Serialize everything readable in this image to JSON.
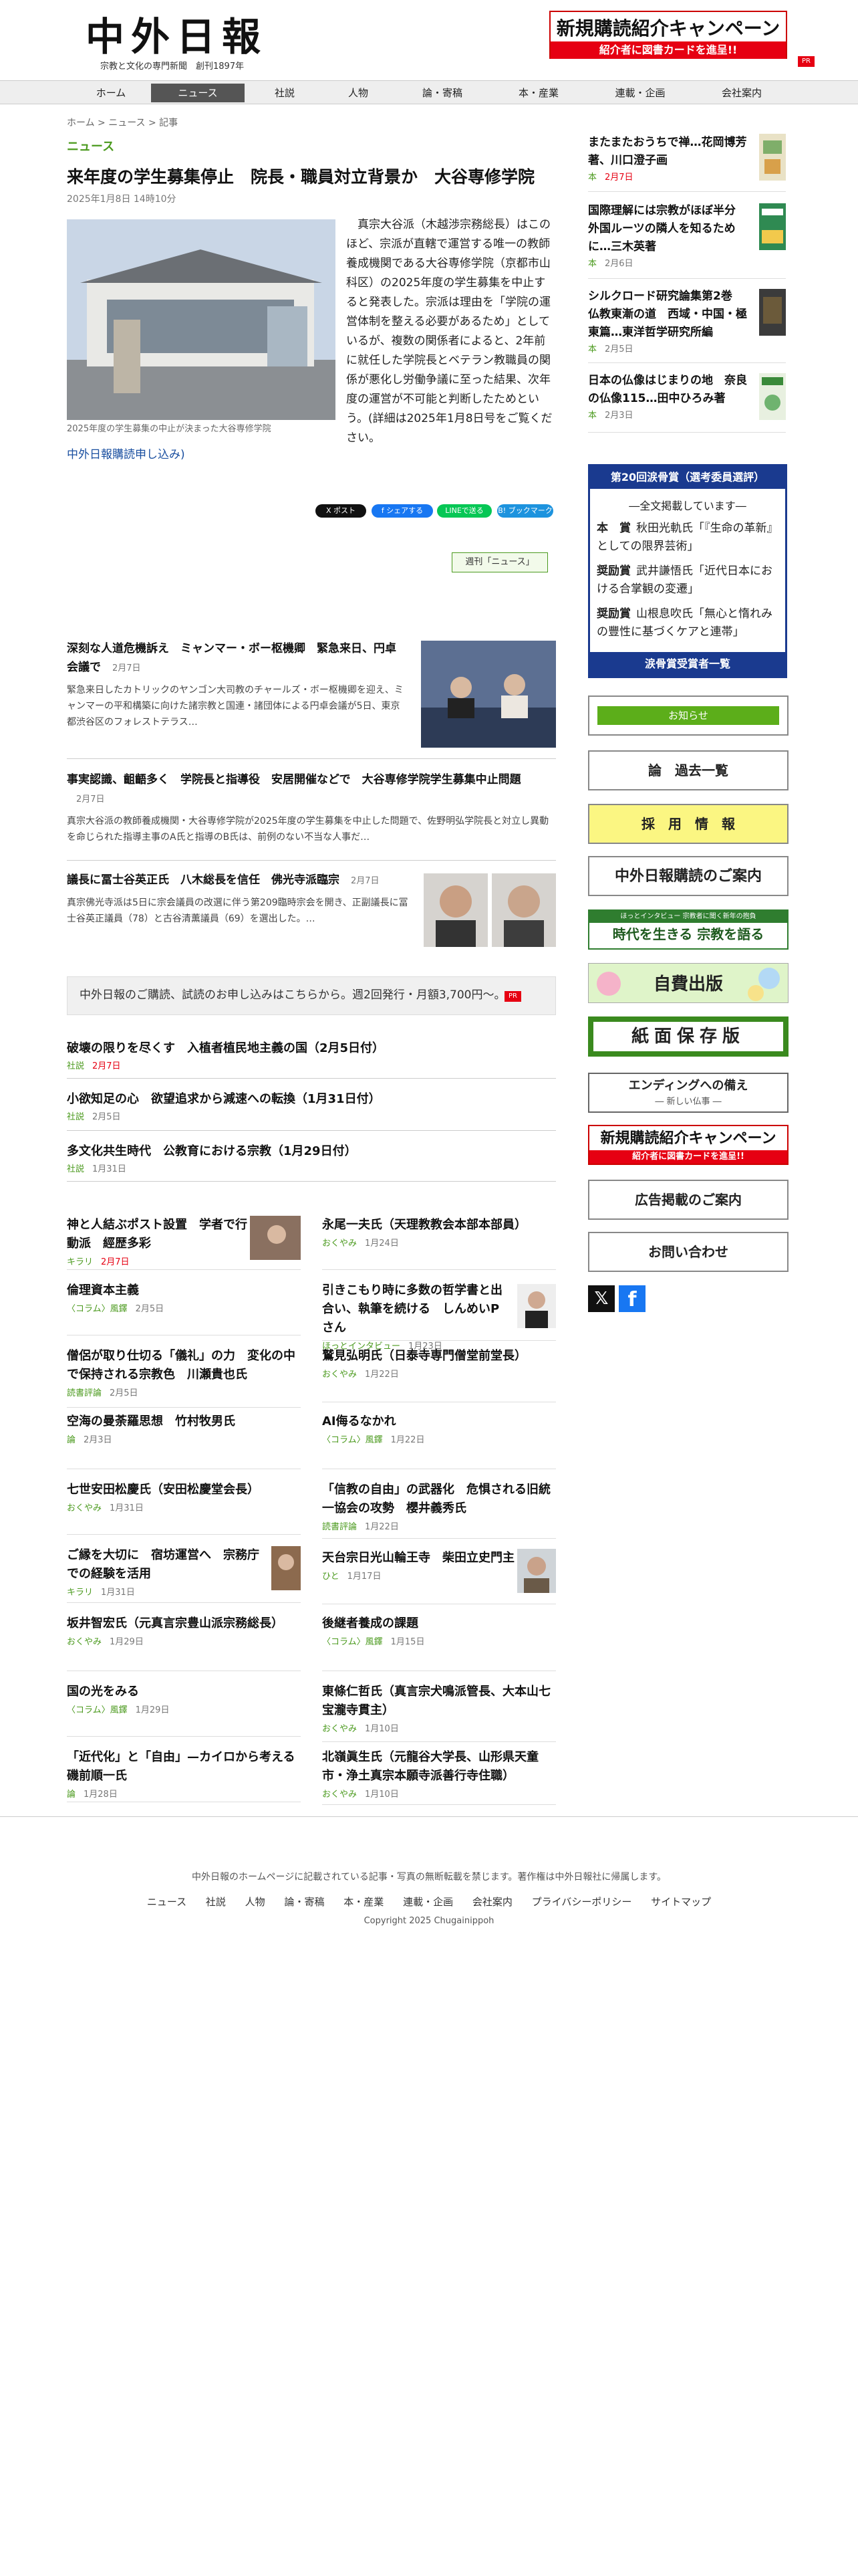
{
  "header": {
    "logo": "中外日報",
    "tagline": "宗教と文化の専門新聞　創刊1897年",
    "banner_main": "新規購読紹介キャンペーン",
    "banner_sub": "紹介者に図書カードを進呈!!",
    "pr": "PR"
  },
  "nav": [
    "ホーム",
    "ニュース",
    "社説",
    "人物",
    "論・寄稿",
    "本・産業",
    "連載・企画",
    "会社案内"
  ],
  "nav_active": 1,
  "breadcrumb": "ホーム > ニュース > 記事",
  "section": "ニュース",
  "article": {
    "title": "来年度の学生募集停止　院長・職員対立背景か　大谷専修学院",
    "date": "2025年1月8日 14時10分",
    "caption": "2025年度の学生募集の中止が決まった大谷専修学院",
    "body": "真宗大谷派（木越渉宗務総長）はこのほど、宗派が直轄で運営する唯一の教師養成機関である大谷専修学院（京都市山科区）の2025年度の学生募集を中止すると発表した。宗派は理由を「学院の運営体制を整える必要があるため」としているが、複数の関係者によると、2年前に就任した学院長とベテラン教職員の関係が悪化し労働争議に至った結果、次年度の運営が不可能と判断したためという。(詳細は2025年1月8日号をご覧ください。",
    "more": "中外日報購読申し込み)"
  },
  "share": [
    "X ポスト",
    "f シェアする",
    "LINEで送る",
    "B! ブックマーク"
  ],
  "series_tag": "週刊「ニュース」",
  "list": [
    {
      "title": "深刻な人道危機訴え　ミャンマー・ボー枢機卿　緊急来日、円卓会議で",
      "date": "2月7日",
      "excerpt": "緊急来日したカトリックのヤンゴン大司教のチャールズ・ボー枢機卿を迎え、ミャンマーの平和構築に向けた諸宗教と国連・諸団体による円卓会議が5日、東京都渋谷区のフォレストテラス…"
    },
    {
      "title": "事実認識、齟齬多く　学院長と指導役　安居開催などで　大谷専修学院学生募集中止問題",
      "date": "2月7日",
      "excerpt": "真宗大谷派の教師養成機関・大谷専修学院が2025年度の学生募集を中止した問題で、佐野明弘学院長と対立し異動を命じられた指導主事のA氏と指導のB氏は、前例のない不当な人事だ…"
    },
    {
      "title": "議長に冨士谷英正氏　八木総長を信任　佛光寺派臨宗",
      "date": "2月7日",
      "excerpt": "真宗佛光寺派は5日に宗会議員の改選に伴う第209臨時宗会を開き、正副議長に冨士谷英正議員（78）と古谷清薫議員（69）を選出した。…"
    }
  ],
  "subscribe": "中外日報のご購読、試読のお申し込みはこちらから。週2回発行・月額3,700円〜。",
  "editorials": [
    {
      "title": "破壊の限りを尽くす　入植者植民地主義の国（2月5日付）",
      "cat": "社説",
      "date": "2月7日",
      "red": true
    },
    {
      "title": "小欲知足の心　欲望追求から減速への転換（1月31日付）",
      "cat": "社説",
      "date": "2月5日",
      "red": false
    },
    {
      "title": "多文化共生時代　公教育における宗教（1月29日付）",
      "cat": "社説",
      "date": "1月31日",
      "red": false
    }
  ],
  "grid_left": [
    {
      "title": "神と人結ぶポスト設置　学者で行動派　經歴多彩",
      "cat": "キラリ",
      "date": "2月7日",
      "red": true
    },
    {
      "title": "倫理資本主義",
      "cat": "〈コラム〉風鐸",
      "date": "2月5日",
      "red": false
    },
    {
      "title": "僧侶が取り仕切る「儀礼」の力　変化の中で保持される宗教色　川瀬貴也氏",
      "cat": "読書評論",
      "date": "2月5日",
      "red": false
    },
    {
      "title": "空海の曼荼羅思想　竹村牧男氏",
      "cat": "論",
      "date": "2月3日",
      "red": false
    },
    {
      "title": "七世安田松慶氏（安田松慶堂会長）",
      "cat": "おくやみ",
      "date": "1月31日",
      "red": false
    },
    {
      "title": "ご縁を大切に　宿坊運営へ　宗務庁での経験を活用",
      "cat": "キラリ",
      "date": "1月31日",
      "red": false
    },
    {
      "title": "坂井智宏氏（元真言宗豊山派宗務総長）",
      "cat": "おくやみ",
      "date": "1月29日",
      "red": false
    },
    {
      "title": "国の光をみる",
      "cat": "〈コラム〉風鐸",
      "date": "1月29日",
      "red": false
    },
    {
      "title": "「近代化」と「自由」—カイロから考える　磯前順一氏",
      "cat": "論",
      "date": "1月28日",
      "red": false
    }
  ],
  "grid_right": [
    {
      "title": "永尾一夫氏（天理教教会本部本部員）",
      "cat": "おくやみ",
      "date": "1月24日"
    },
    {
      "title": "引きこもり時に多数の哲学書と出合い、執筆を続ける　しんめいPさん",
      "cat": "ほっとインタビュー",
      "date": "1月23日"
    },
    {
      "title": "鷲見弘明氏（日泰寺専門僧堂前堂長）",
      "cat": "おくやみ",
      "date": "1月22日"
    },
    {
      "title": "AI侮るなかれ",
      "cat": "〈コラム〉風鐸",
      "date": "1月22日"
    },
    {
      "title": "「信教の自由」の武器化　危惧される旧統一協会の攻勢　櫻井義秀氏",
      "cat": "読書評論",
      "date": "1月22日"
    },
    {
      "title": "天台宗日光山輪王寺　柴田立史門主",
      "cat": "ひと",
      "date": "1月17日"
    },
    {
      "title": "後継者養成の課題",
      "cat": "〈コラム〉風鐸",
      "date": "1月15日"
    },
    {
      "title": "東條仁哲氏（真言宗犬鳴派管長、大本山七宝瀧寺貫主）",
      "cat": "おくやみ",
      "date": "1月10日"
    },
    {
      "title": "北嶺眞生氏（元龍谷大学長、山形県天童市・浄土真宗本願寺派善行寺住職）",
      "cat": "おくやみ",
      "date": "1月10日"
    }
  ],
  "sidebar": {
    "articles": [
      {
        "title": "またまたおうちで禅…花岡博芳著、川口澄子画",
        "cat": "本",
        "date": "2月7日",
        "red": true
      },
      {
        "title": "国際理解には宗教がほぼ半分　外国ルーツの隣人を知るために…三木英著",
        "cat": "本",
        "date": "2月6日",
        "red": false
      },
      {
        "title": "シルクロード研究論集第2巻　仏教東漸の道　西域・中国・極東篇…東洋哲学研究所編",
        "cat": "本",
        "date": "2月5日",
        "red": false
      },
      {
        "title": "日本の仏像はじまりの地　奈良の仏像115…田中ひろみ著",
        "cat": "本",
        "date": "2月3日",
        "red": false
      }
    ],
    "award": {
      "header": "第20回涙骨賞（選考委員選評）",
      "all": "―全文掲載しています―",
      "rows": [
        {
          "k": "本　賞",
          "v": "秋田光軌氏「『生命の革新』としての限界芸術」"
        },
        {
          "k": "奨励賞",
          "v": "武井謙悟氏「近代日本における合掌観の変遷」"
        },
        {
          "k": "奨励賞",
          "v": "山根息吹氏「無心と惰れみの豐性に基づくケアと連帯」"
        }
      ],
      "footer": "涙骨賞受賞者一覧"
    },
    "notice": "お知らせ",
    "past": "論　過去一覧",
    "recruit": "採　用　情　報",
    "subscribe_guide": "中外日報購読のご案内",
    "shukyo_1": "ほっとインタビュー 宗教者に聞く新年の抱負",
    "shukyo_2": "時代を生きる 宗教を語る",
    "self_pub": "自費出版",
    "archive": "紙面保存版",
    "ending_1": "エンディングへの備え",
    "ending_2": "― 新しい仏事 ―",
    "camp_main": "新規購読紹介キャンペーン",
    "camp_sub": "紹介者に図書カードを進呈!!",
    "ads": "広告掲載のご案内",
    "contact": "お問い合わせ"
  },
  "footer": {
    "note": "中外日報のホームページに記載されている記事・写真の無断転載を禁じます。著作権は中外日報社に帰属します。",
    "links": [
      "ニュース",
      "社説",
      "人物",
      "論・寄稿",
      "本・産業",
      "連載・企画",
      "会社案内",
      "プライバシーポリシー",
      "サイトマップ"
    ],
    "copy": "Copyright 2025 Chugainippoh"
  },
  "colors": {
    "accent_green": "#4b9a1e",
    "red": "#e60012",
    "navy": "#1a3a8f"
  }
}
